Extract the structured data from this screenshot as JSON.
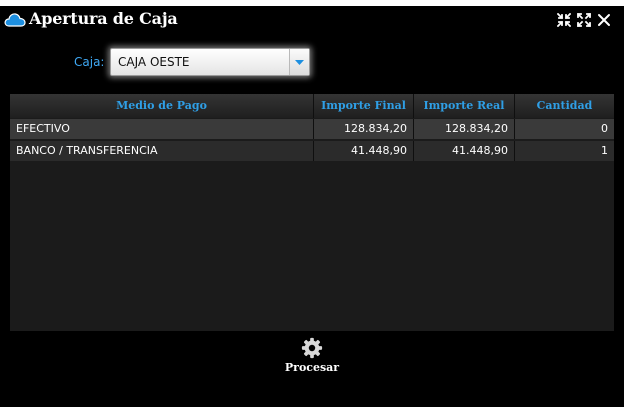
{
  "window": {
    "title": "Apertura de Caja",
    "icons": {
      "app": "cloud-icon",
      "collapse": "collapse-arrows-icon",
      "expand": "expand-arrows-icon",
      "close": "close-icon"
    }
  },
  "form": {
    "caja_label": "Caja:",
    "caja_value": "CAJA OESTE"
  },
  "table": {
    "columns": [
      "Medio de Pago",
      "Importe Final",
      "Importe Real",
      "Cantidad"
    ],
    "rows": [
      {
        "medio": "EFECTIVO",
        "importe_final": "128.834,20",
        "importe_real": "128.834,20",
        "cantidad": "0"
      },
      {
        "medio": "BANCO / TRANSFERENCIA",
        "importe_final": "41.448,90",
        "importe_real": "41.448,90",
        "cantidad": "1"
      }
    ]
  },
  "actions": {
    "process_label": "Procesar",
    "process_icon": "gear-icon"
  },
  "colors": {
    "background": "#000000",
    "accent": "#2f9fe6",
    "row_even": "#3a3a3a",
    "row_odd": "#2b2b2b"
  }
}
